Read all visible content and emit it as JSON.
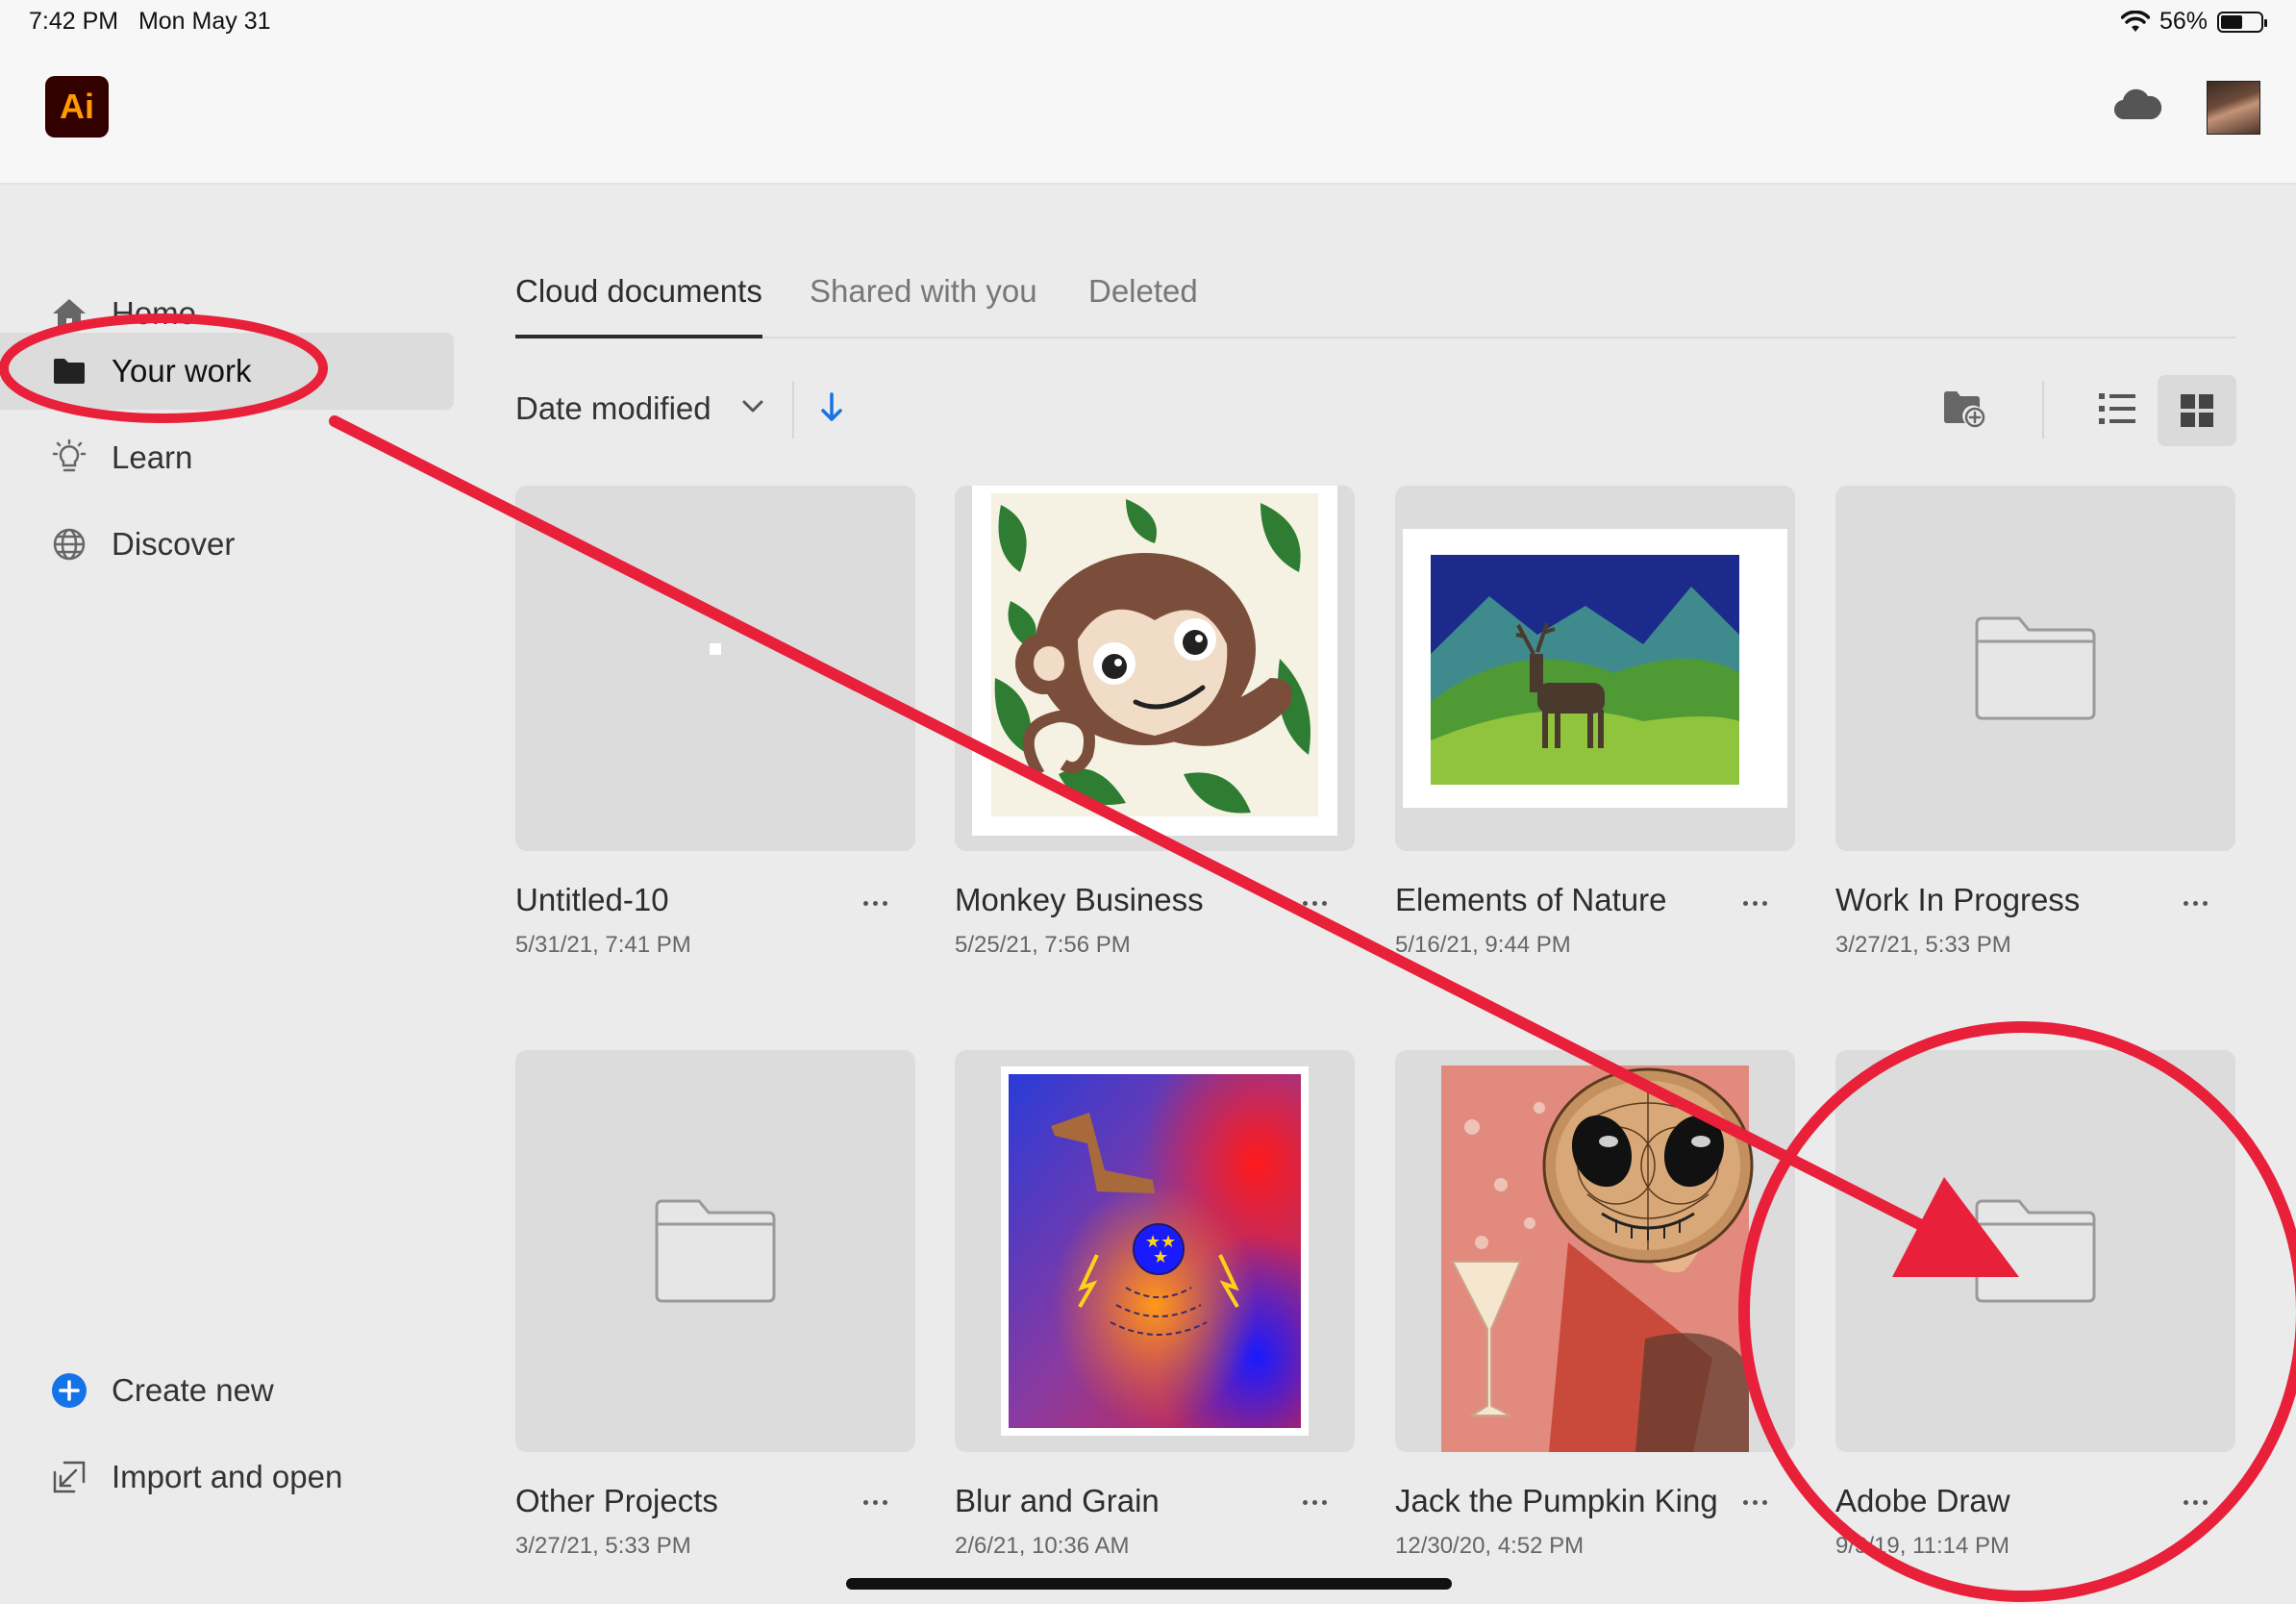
{
  "status": {
    "time": "7:42 PM",
    "date": "Mon May 31",
    "battery": "56%",
    "battery_level": 0.56
  },
  "app": {
    "logo_text": "Ai"
  },
  "sidebar": {
    "items": [
      {
        "label": "Home",
        "icon": "home-icon"
      },
      {
        "label": "Your work",
        "icon": "folder-icon",
        "selected": true
      },
      {
        "label": "Learn",
        "icon": "lightbulb-icon"
      },
      {
        "label": "Discover",
        "icon": "globe-icon"
      }
    ],
    "actions": [
      {
        "label": "Create new",
        "icon": "plus-circle-icon"
      },
      {
        "label": "Import and open",
        "icon": "import-icon"
      }
    ]
  },
  "tabs": [
    {
      "label": "Cloud documents",
      "active": true
    },
    {
      "label": "Shared with you"
    },
    {
      "label": "Deleted"
    }
  ],
  "sort": {
    "label": "Date modified",
    "direction": "descending"
  },
  "view": {
    "mode": "grid"
  },
  "documents": [
    {
      "title": "Untitled-10",
      "date": "5/31/21, 7:41 PM",
      "kind": "blank"
    },
    {
      "title": "Monkey Business",
      "date": "5/25/21, 7:56 PM",
      "kind": "artwork"
    },
    {
      "title": "Elements of Nature",
      "date": "5/16/21, 9:44 PM",
      "kind": "artwork"
    },
    {
      "title": "Work In Progress",
      "date": "3/27/21, 5:33 PM",
      "kind": "folder"
    },
    {
      "title": "Other Projects",
      "date": "3/27/21, 5:33 PM",
      "kind": "folder"
    },
    {
      "title": "Blur and Grain",
      "date": "2/6/21, 10:36 AM",
      "kind": "artwork"
    },
    {
      "title": "Jack the Pumpkin King",
      "date": "12/30/20, 4:52 PM",
      "kind": "artwork"
    },
    {
      "title": "Adobe Draw",
      "date": "9/3/19, 11:14 PM",
      "kind": "folder"
    }
  ],
  "annotation_color": "#e8203a",
  "accent_color": "#1473e6"
}
